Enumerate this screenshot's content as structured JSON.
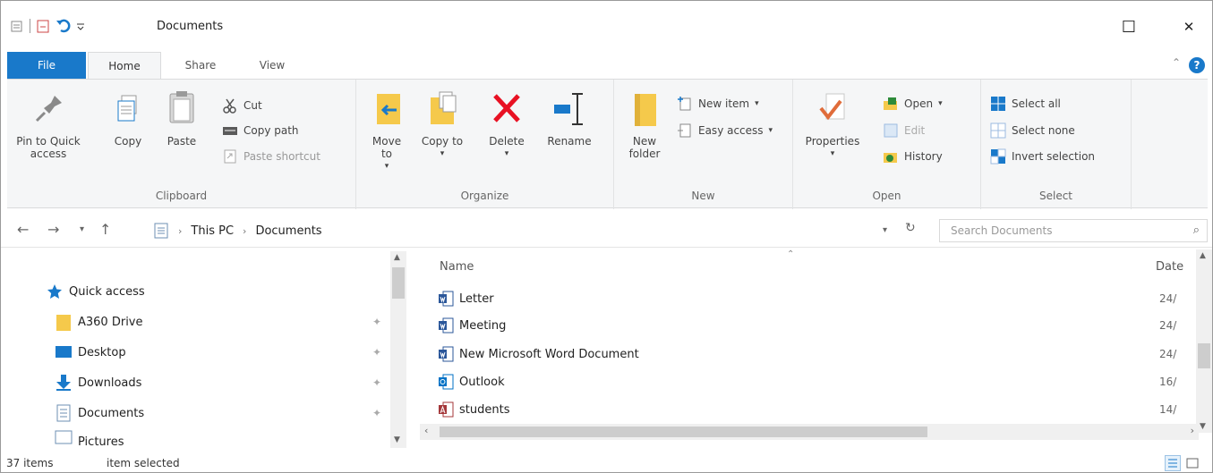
{
  "window": {
    "title": "Documents",
    "maximize_glyph": "☐",
    "close_glyph": "✕"
  },
  "tabs": [
    "File",
    "Home",
    "Share",
    "View"
  ],
  "ribbon": {
    "clipboard": {
      "label": "Clipboard",
      "pin": "Pin to Quick access",
      "copy": "Copy",
      "paste": "Paste",
      "cut": "Cut",
      "copy_path": "Copy path",
      "paste_shortcut": "Paste shortcut"
    },
    "organize": {
      "label": "Organize",
      "move_to": "Move to",
      "copy_to": "Copy to",
      "delete": "Delete",
      "rename": "Rename"
    },
    "new": {
      "label": "New",
      "new_folder": "New folder",
      "new_item": "New item",
      "easy_access": "Easy access"
    },
    "open": {
      "label": "Open",
      "properties": "Properties",
      "open": "Open",
      "edit": "Edit",
      "history": "History"
    },
    "select": {
      "label": "Select",
      "select_all": "Select all",
      "select_none": "Select none",
      "invert_selection": "Invert selection"
    }
  },
  "address": {
    "crumbs": [
      "This PC",
      "Documents"
    ],
    "search_placeholder": "Search Documents"
  },
  "nav": {
    "quick_access": "Quick access",
    "items": [
      "A360 Drive",
      "Desktop",
      "Downloads",
      "Documents",
      "Pictures"
    ]
  },
  "filelist": {
    "col_name": "Name",
    "col_date": "Date",
    "files": [
      {
        "name": "Letter",
        "date": "24/"
      },
      {
        "name": "Meeting",
        "date": "24/"
      },
      {
        "name": "New Microsoft Word Document",
        "date": "24/"
      },
      {
        "name": "Outlook",
        "date": "16/"
      },
      {
        "name": "students",
        "date": "14/"
      }
    ]
  },
  "status": {
    "item_count": "37 items",
    "selected": "item selected"
  },
  "colors": {
    "accent": "#1979ca",
    "ribbon_bg": "#f5f6f7",
    "delete_red": "#e81123",
    "folder_yellow": "#f5c94b"
  }
}
